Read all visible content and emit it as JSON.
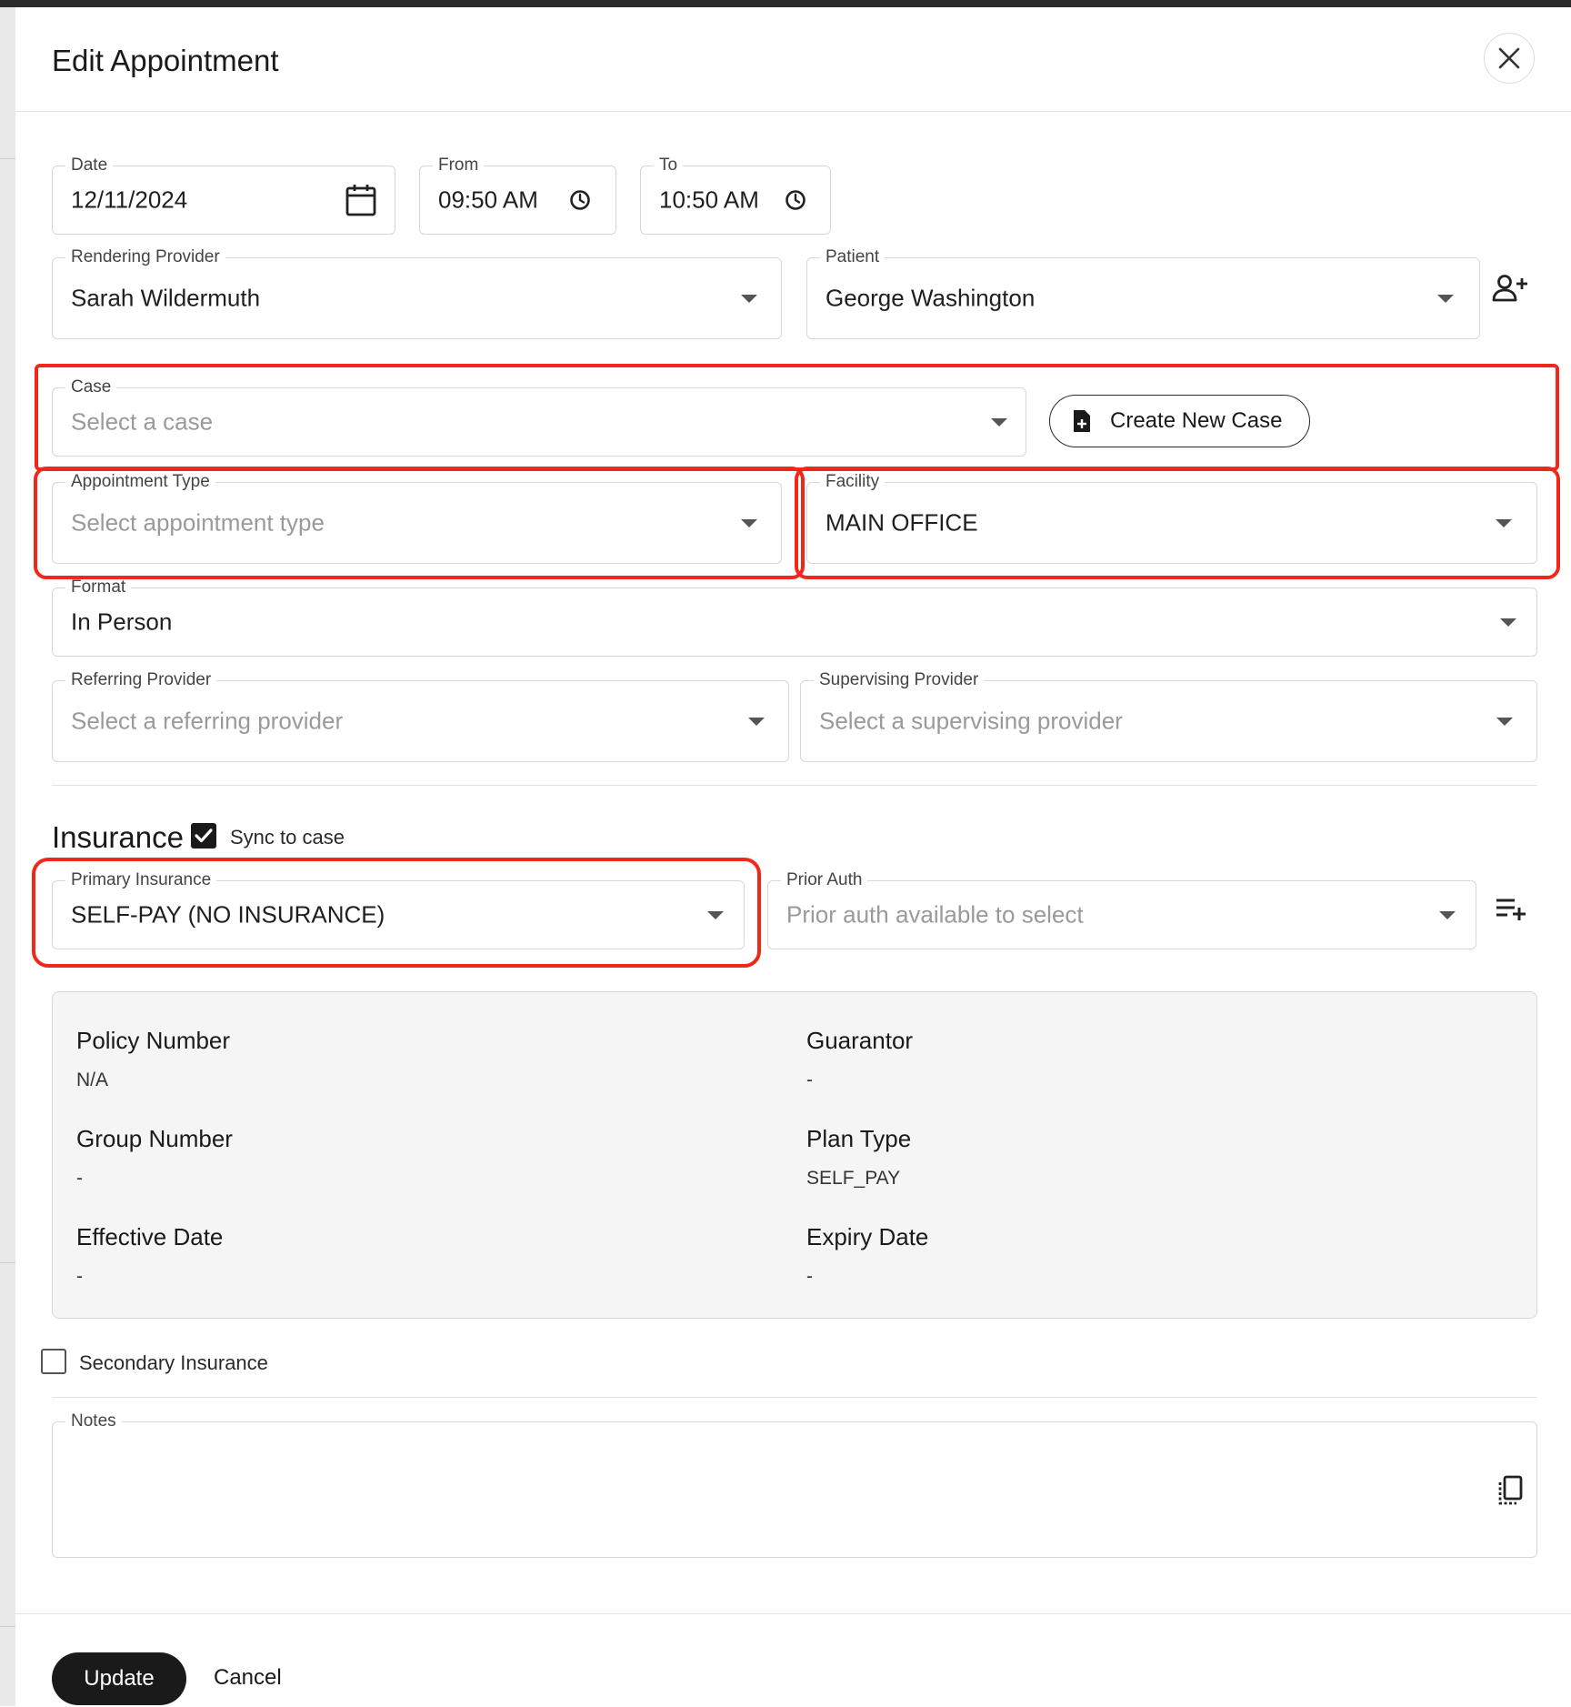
{
  "dialog": {
    "title": "Edit Appointment"
  },
  "schedule": {
    "date_label": "Date",
    "date_value": "12/11/2024",
    "from_label": "From",
    "from_value": "09:50 AM",
    "to_label": "To",
    "to_value": "10:50 AM"
  },
  "rendering_provider": {
    "label": "Rendering Provider",
    "value": "Sarah Wildermuth"
  },
  "patient": {
    "label": "Patient",
    "value": "George Washington"
  },
  "case": {
    "label": "Case",
    "placeholder": "Select a case",
    "create_label": "Create New Case"
  },
  "appointment_type": {
    "label": "Appointment Type",
    "placeholder": "Select appointment type"
  },
  "facility": {
    "label": "Facility",
    "value": "MAIN OFFICE"
  },
  "format": {
    "label": "Format",
    "value": "In Person"
  },
  "referring_provider": {
    "label": "Referring Provider",
    "placeholder": "Select a referring provider"
  },
  "supervising_provider": {
    "label": "Supervising Provider",
    "placeholder": "Select a supervising provider"
  },
  "insurance": {
    "title": "Insurance",
    "sync_label": "Sync to case",
    "sync_checked": true,
    "primary_label": "Primary Insurance",
    "primary_value": "SELF-PAY (NO INSURANCE)",
    "prior_auth_label": "Prior Auth",
    "prior_auth_placeholder": "Prior auth available to select",
    "details": {
      "policy_number_label": "Policy Number",
      "policy_number_value": "N/A",
      "guarantor_label": "Guarantor",
      "guarantor_value": "-",
      "group_number_label": "Group Number",
      "group_number_value": "-",
      "plan_type_label": "Plan Type",
      "plan_type_value": "SELF_PAY",
      "effective_date_label": "Effective Date",
      "effective_date_value": "-",
      "expiry_date_label": "Expiry Date",
      "expiry_date_value": "-"
    },
    "secondary_label": "Secondary Insurance",
    "secondary_checked": false
  },
  "notes": {
    "label": "Notes",
    "value": ""
  },
  "footer": {
    "update_label": "Update",
    "cancel_label": "Cancel"
  },
  "colors": {
    "highlight": "#f0281c",
    "primary_button": "#1a1a1a"
  },
  "icons": {
    "close": "close-icon",
    "calendar": "calendar-icon",
    "clock": "clock-icon",
    "add_person": "add-person-icon",
    "new_file": "new-file-icon",
    "dropdown": "chevron-down-icon",
    "playlist_add": "playlist-add-icon",
    "copy": "copy-icon"
  }
}
